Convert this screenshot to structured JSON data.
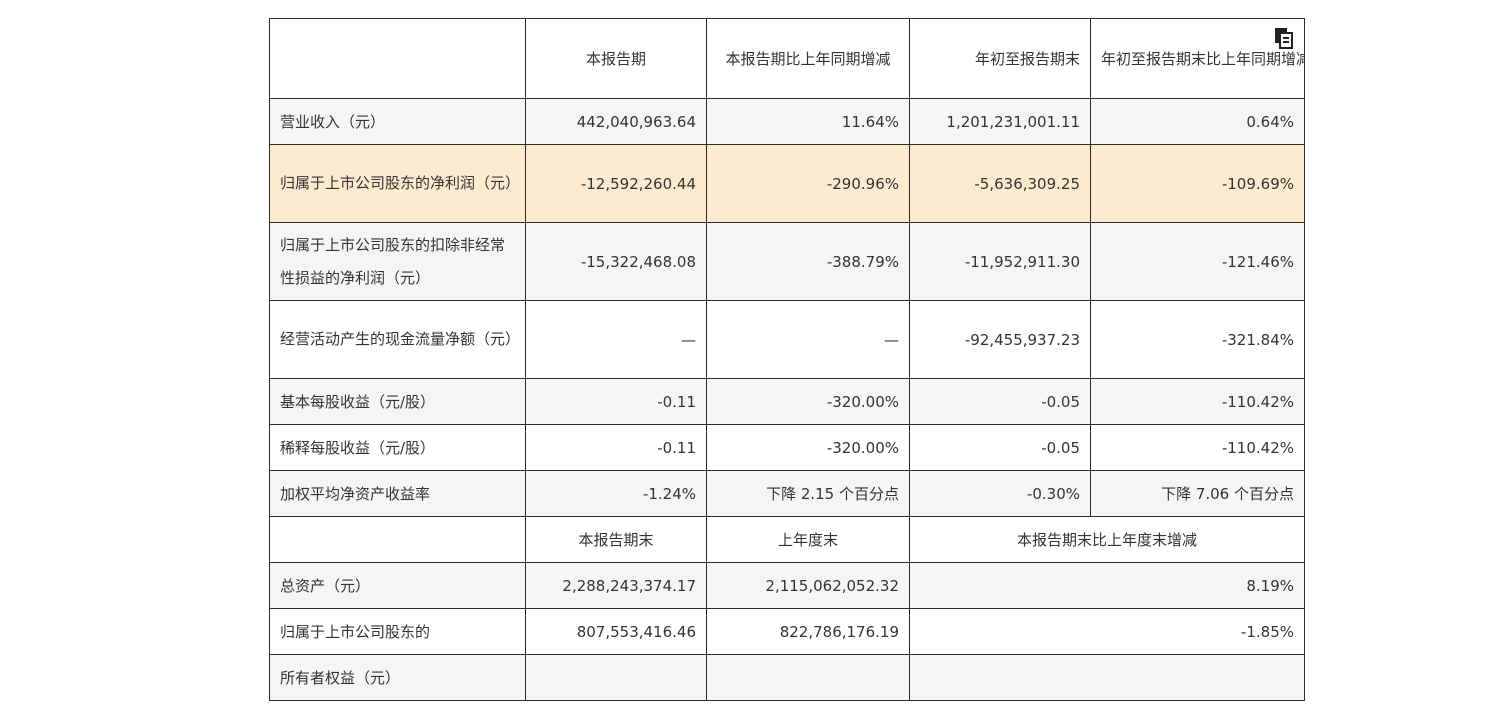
{
  "header": {
    "c1": "本报告期",
    "c2": "本报告期比上年同期增减",
    "c3": "年初至报告期末",
    "c4": "年初至报告期末比上年同期增减"
  },
  "rows": [
    {
      "label": "营业收入（元）",
      "v1": "442,040,963.64",
      "v2": "11.64%",
      "v3": "1,201,231,001.11",
      "v4": "0.64%"
    },
    {
      "label": "归属于上市公司股东的净利润（元）",
      "v1": "-12,592,260.44",
      "v2": "-290.96%",
      "v3": "-5,636,309.25",
      "v4": "-109.69%"
    },
    {
      "label": "归属于上市公司股东的扣除非经常性损益的净利润（元）",
      "v1": "-15,322,468.08",
      "v2": "-388.79%",
      "v3": "-11,952,911.30",
      "v4": "-121.46%"
    },
    {
      "label": "经营活动产生的现金流量净额（元）",
      "v1": "—",
      "v2": "—",
      "v3": "-92,455,937.23",
      "v4": "-321.84%"
    },
    {
      "label": "基本每股收益（元/股）",
      "v1": "-0.11",
      "v2": "-320.00%",
      "v3": "-0.05",
      "v4": "-110.42%"
    },
    {
      "label": "稀释每股收益（元/股）",
      "v1": "-0.11",
      "v2": "-320.00%",
      "v3": "-0.05",
      "v4": "-110.42%"
    },
    {
      "label": "加权平均净资产收益率",
      "v1": "-1.24%",
      "v2": "下降 2.15 个百分点",
      "v3": "-0.30%",
      "v4": "下降 7.06 个百分点"
    }
  ],
  "header2": {
    "c1": "本报告期末",
    "c2": "上年度末",
    "c3": "本报告期末比上年度末增减"
  },
  "rows2": [
    {
      "label": "总资产（元）",
      "v1": "2,288,243,374.17",
      "v2": "2,115,062,052.32",
      "v3": "8.19%"
    },
    {
      "label": "归属于上市公司股东的",
      "v1": "807,553,416.46",
      "v2": "822,786,176.19",
      "v3": "-1.85%"
    },
    {
      "label": "所有者权益（元）",
      "v1": "",
      "v2": "",
      "v3": ""
    }
  ],
  "icons": {
    "copy": "copy-icon"
  }
}
